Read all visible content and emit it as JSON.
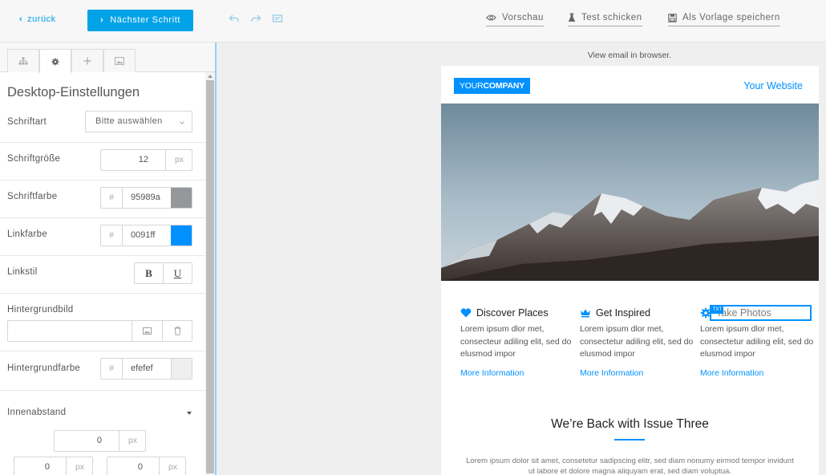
{
  "toolbar": {
    "back_label": "zurück",
    "next_label": "Nächster Schritt",
    "preview_label": "Vorschau",
    "test_label": "Test schicken",
    "template_label": "Als Vorlage speichern"
  },
  "sidebar": {
    "title": "Desktop-Einstellungen",
    "font_label": "Schriftart",
    "font_select_value": "Bitte auswählen",
    "font_size_label": "Schriftgröße",
    "font_size_value": "12",
    "font_size_unit": "px",
    "font_color_label": "Schriftfarbe",
    "font_color_hash": "#",
    "font_color_value": "95989a",
    "font_color_swatch": "#95989a",
    "link_color_label": "Linkfarbe",
    "link_color_hash": "#",
    "link_color_value": "0091ff",
    "link_color_swatch": "#0091ff",
    "link_style_label": "Linkstil",
    "bold_label": "B",
    "underline_label": "U",
    "bg_image_label": "Hintergrundbild",
    "bg_color_label": "Hintergrundfarbe",
    "bg_color_hash": "#",
    "bg_color_value": "efefef",
    "bg_color_swatch": "#efefef",
    "padding_label": "Innenabstand",
    "padding_top_value": "0",
    "padding_left_value": "0",
    "padding_right_value": "0",
    "padding_unit": "px"
  },
  "email": {
    "view_in_browser": "View email in browser.",
    "logo_prefix": "YOUR",
    "logo_bold": "COMPANY",
    "website_link": "Your Website",
    "edit_tag": "TXT",
    "columns": [
      {
        "title": "Discover Places",
        "icon": "heart-icon",
        "text": "Lorem ipsum dlor met, consecteur adiling elit, sed do elusmod impor",
        "link": "More Information"
      },
      {
        "title": "Get Inspired",
        "icon": "crown-icon",
        "text": "Lorem ipsum dlor met, consectetur adiling elit, sed do elusmod impor",
        "link": "More Information"
      },
      {
        "title": "Take Photos",
        "icon": "gear-icon",
        "text": "Lorem ipsum dlor met, consectetur adiling elit, sed do elusmod impor",
        "link": "More Information"
      }
    ],
    "issue_title": "We’re Back with Issue Three",
    "issue_text": "Lorem ipsum dolor sit amet, consetetur sadipscing elitr, sed diam nonumy eirmod tempor invidunt ut labore et dolore magna aliquyam erat, sed diam voluptua."
  },
  "colors": {
    "accent": "#00a2e8",
    "link": "#0091ff"
  }
}
